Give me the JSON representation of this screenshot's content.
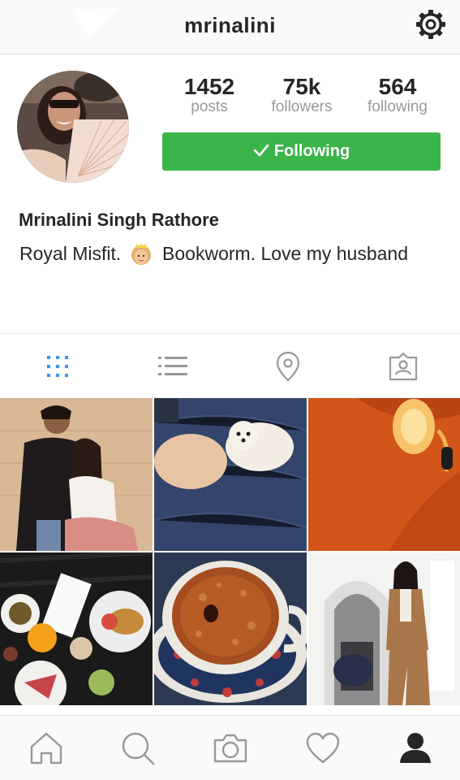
{
  "header": {
    "username": "mrinalini",
    "settings_icon": "gear-icon"
  },
  "profile": {
    "display_name": "Mrinalini Singh Rathore",
    "bio_before": "Royal Misfit.",
    "bio_after": "Bookworm. Love my husband",
    "bio_emoji": "princess-emoji"
  },
  "stats": {
    "posts": {
      "value": "1452",
      "label": "posts"
    },
    "followers": {
      "value": "75k",
      "label": "followers"
    },
    "following": {
      "value": "564",
      "label": "following"
    }
  },
  "follow_button": {
    "label": "Following",
    "color": "#3bb44a"
  },
  "tabs": [
    {
      "icon": "grid-icon",
      "active": true
    },
    {
      "icon": "list-icon",
      "active": false
    },
    {
      "icon": "location-pin-icon",
      "active": false
    },
    {
      "icon": "tagged-user-icon",
      "active": false
    }
  ],
  "posts": [
    {
      "subject": "couple-photo"
    },
    {
      "subject": "puppies-on-bed"
    },
    {
      "subject": "diamond-ring"
    },
    {
      "subject": "breakfast-table"
    },
    {
      "subject": "coffee-cup"
    },
    {
      "subject": "woman-in-suit"
    }
  ],
  "bottom_nav": [
    {
      "icon": "home-icon"
    },
    {
      "icon": "search-icon"
    },
    {
      "icon": "camera-icon"
    },
    {
      "icon": "heart-icon"
    },
    {
      "icon": "profile-icon",
      "active": true
    }
  ],
  "colors": {
    "accent_blue": "#3897f0",
    "active_icon": "#262626",
    "inactive_icon": "#999999"
  }
}
